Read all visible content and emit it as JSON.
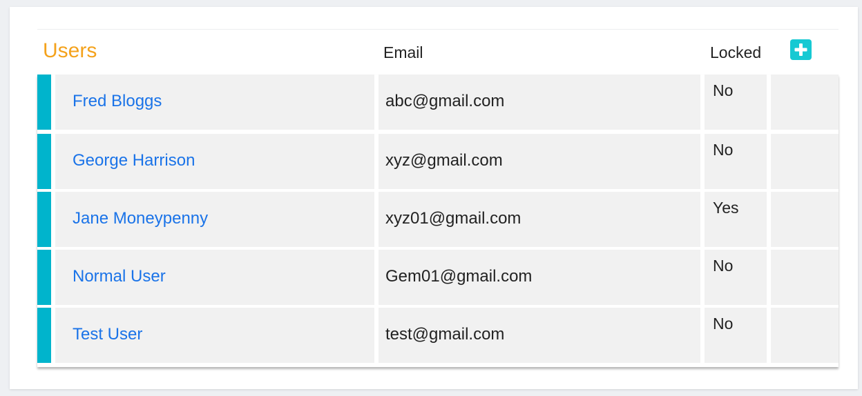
{
  "header": {
    "title": "Users",
    "email_column": "Email",
    "locked_column": "Locked",
    "add_icon": "plus-icon"
  },
  "users": [
    {
      "name": "Fred Bloggs",
      "email": "abc@gmail.com",
      "locked": "No"
    },
    {
      "name": "George Harrison",
      "email": "xyz@gmail.com",
      "locked": "No"
    },
    {
      "name": "Jane Moneypenny",
      "email": "xyz01@gmail.com",
      "locked": "Yes"
    },
    {
      "name": "Normal User",
      "email": "Gem01@gmail.com",
      "locked": "No"
    },
    {
      "name": "Test User",
      "email": "test@gmail.com",
      "locked": "No"
    }
  ],
  "colors": {
    "title": "#f4a21c",
    "accent": "#00b4cc",
    "link": "#1a73e8",
    "add_button": "#16c9d3"
  }
}
